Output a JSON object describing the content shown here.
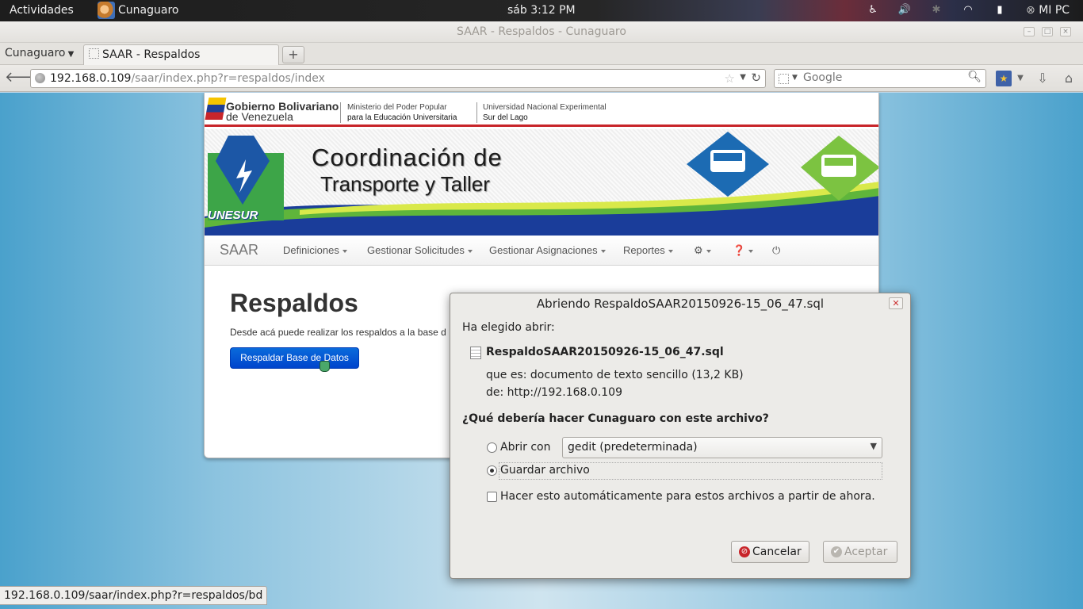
{
  "topbar": {
    "activities": "Actividades",
    "app_name": "Cunaguaro",
    "clock": "sáb  3:12 PM",
    "user": "MI PC"
  },
  "window": {
    "title": "SAAR - Respaldos - Cunaguaro"
  },
  "tabs": {
    "menu_label": "Cunaguaro",
    "active_tab": "SAAR - Respaldos",
    "new_tab": "+"
  },
  "navbar": {
    "url_host": "192.168.0.109",
    "url_path": "/saar/index.php?r=respaldos/index",
    "search_placeholder": "Google"
  },
  "site": {
    "gov_name_1": "Gobierno Bolivariano",
    "gov_name_2": "de Venezuela",
    "ministry_1": "Ministerio del Poder Popular",
    "ministry_2": "para la Educación Universitaria",
    "university_1": "Universidad Nacional Experimental",
    "university_2": "Sur del Lago",
    "banner_title_1": "Coordinación de",
    "banner_title_2": "Transporte y Taller",
    "logo_text": "UNESUR",
    "brand": "SAAR",
    "nav": [
      "Definiciones",
      "Gestionar Solicitudes",
      "Gestionar Asignaciones",
      "Reportes"
    ]
  },
  "content": {
    "title": "Respaldos",
    "description": "Desde acá puede realizar los respaldos a la base d",
    "button": "Respaldar Base de Datos"
  },
  "statusbar": {
    "text": "192.168.0.109/saar/index.php?r=respaldos/bd"
  },
  "dialog": {
    "title": "Abriendo RespaldoSAAR20150926-15_06_47.sql",
    "chosen_label": "Ha elegido abrir:",
    "filename": "RespaldoSAAR20150926-15_06_47.sql",
    "type_label": "que es:",
    "type_value": "documento de texto sencillo (13,2 KB)",
    "from_label": "de:",
    "from_value": "http://192.168.0.109",
    "question": "¿Qué debería hacer Cunaguaro con este archivo?",
    "open_with_label": "Abrir con",
    "open_with_app": "gedit (predeterminada)",
    "save_label": "Guardar archivo",
    "auto_label": "Hacer esto automáticamente para estos archivos a partir de ahora.",
    "cancel": "Cancelar",
    "accept": "Aceptar",
    "selected_option": "save"
  }
}
